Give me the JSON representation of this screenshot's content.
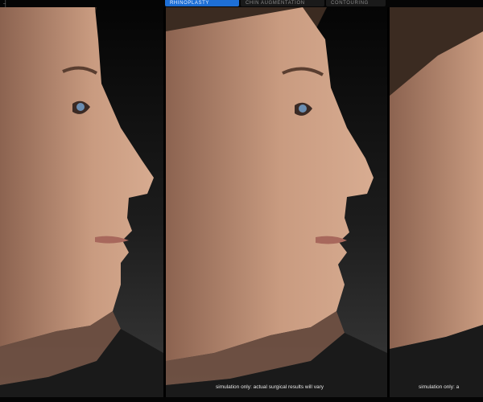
{
  "app": {
    "tabs": [
      {
        "label": "RHINOPLASTY",
        "active": true
      },
      {
        "label": "CHIN AUGMENTATION",
        "active": false
      },
      {
        "label": "CONTOURING",
        "active": false
      }
    ],
    "accent_color": "#1e6fd6"
  },
  "panels": [
    {
      "view": "before-profile",
      "note": ""
    },
    {
      "view": "simulated-profile",
      "note": "simulation only: actual surgical results will vary"
    },
    {
      "view": "simulated-profile-partial",
      "note": "simulation only: a"
    }
  ]
}
